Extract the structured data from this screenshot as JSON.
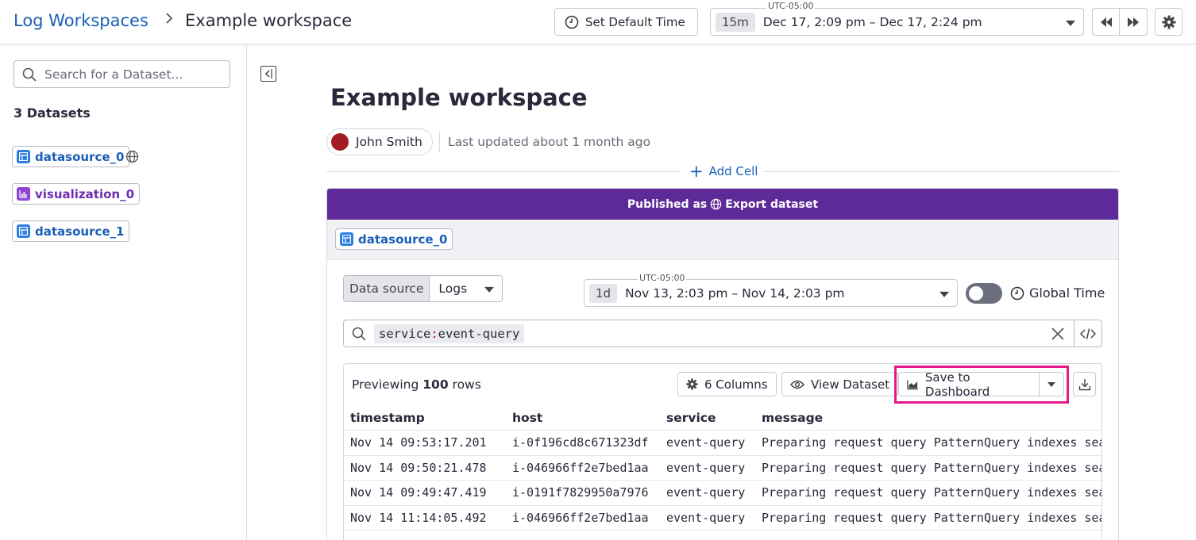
{
  "header": {
    "breadcrumb_root": "Log Workspaces",
    "breadcrumb_current": "Example workspace",
    "set_default_time_label": "Set Default Time",
    "timezone": "UTC-05:00",
    "time_duration": "15m",
    "time_range": "Dec 17, 2:09 pm – Dec 17, 2:24 pm",
    "icons": [
      "clock-icon",
      "rewind-icon",
      "fast-forward-icon",
      "gear-icon",
      "chevron-right-icon"
    ]
  },
  "sidebar": {
    "search_placeholder": "Search for a Dataset...",
    "dataset_count": "3 Datasets",
    "datasets": [
      {
        "name": "datasource_0",
        "kind": "table",
        "published": true
      },
      {
        "name": "visualization_0",
        "kind": "chart",
        "published": false
      },
      {
        "name": "datasource_1",
        "kind": "table",
        "published": false
      }
    ]
  },
  "workspace": {
    "title": "Example workspace",
    "author": "John Smith",
    "last_updated": "Last updated about 1 month ago",
    "add_cell_label": "Add Cell"
  },
  "cell": {
    "published_prefix": "Published as",
    "published_target": "Export dataset",
    "dataset_name": "datasource_0",
    "data_source_label": "Data source",
    "data_source_value": "Logs",
    "timezone": "UTC-05:00",
    "time_duration": "1d",
    "time_range": "Nov 13, 2:03 pm – Nov 14, 2:03 pm",
    "global_time_label": "Global Time",
    "global_time_enabled": false,
    "query": {
      "key": "service",
      "sep": ":",
      "value": "event-query"
    }
  },
  "preview": {
    "prefix": "Previewing",
    "count": "100",
    "suffix": "rows",
    "columns_button": "6 Columns",
    "view_dataset_button": "View Dataset",
    "save_dashboard_button": "Save to Dashboard",
    "highlight_color": "#e6198a",
    "headers": [
      "timestamp",
      "host",
      "service",
      "message"
    ],
    "rows": [
      {
        "timestamp": "Nov 14 09:53:17.201",
        "host": "i-0f196cd8c671323df",
        "service": "event-query",
        "message": "Preparing request query PatternQuery indexes sear"
      },
      {
        "timestamp": "Nov 14 09:50:21.478",
        "host": "i-046966ff2e7bed1aa",
        "service": "event-query",
        "message": "Preparing request query PatternQuery indexes sear"
      },
      {
        "timestamp": "Nov 14 09:49:47.419",
        "host": "i-0191f7829950a7976",
        "service": "event-query",
        "message": "Preparing request query PatternQuery indexes sear"
      },
      {
        "timestamp": "Nov 14 11:14:05.492",
        "host": "i-046966ff2e7bed1aa",
        "service": "event-query",
        "message": "Preparing request query PatternQuery indexes sear"
      }
    ]
  },
  "colors": {
    "brand_blue": "#1b5fb6",
    "banner_purple": "#5e2a97",
    "dataset_blue": "#2e7de1",
    "viz_purple": "#8e45d4"
  }
}
